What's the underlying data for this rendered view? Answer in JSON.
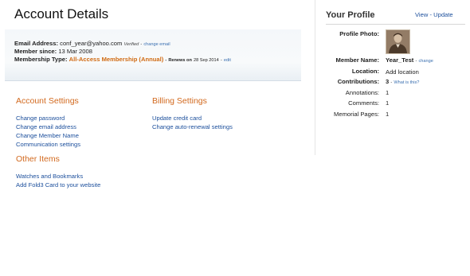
{
  "account": {
    "title": "Account Details",
    "email_label": "Email Address:",
    "email_value": "conf_year@yahoo.com",
    "verified_label": "Verified",
    "change_email_link": "change email",
    "member_since_label": "Member since:",
    "member_since_value": "13 Mar 2008",
    "membership_label": "Membership Type:",
    "membership_value": "All-Access Membership (Annual)",
    "renews_label": "Renews on",
    "renews_date": "28 Sep 2014",
    "edit_link": "edit"
  },
  "account_settings": {
    "title": "Account Settings",
    "links": [
      "Change password",
      "Change email address",
      "Change Member Name",
      "Communication settings"
    ]
  },
  "billing_settings": {
    "title": "Billing Settings",
    "links": [
      "Update credit card",
      "Change auto-renewal settings"
    ]
  },
  "other_items": {
    "title": "Other Items",
    "links": [
      "Watches and Bookmarks",
      "Add Fold3 Card to your website"
    ]
  },
  "profile": {
    "title": "Your Profile",
    "view_link": "View",
    "separator": "-",
    "update_link": "Update",
    "photo_label": "Profile Photo:",
    "member_name_label": "Member Name:",
    "member_name_value": "Year_Test",
    "change_link": "change",
    "location_label": "Location:",
    "add_location_link": "Add location",
    "contributions_label": "Contributions:",
    "contributions_value": "3",
    "what_is_this_link": "What is this?",
    "annotations_label": "Annotations:",
    "annotations_value": "1",
    "comments_label": "Comments:",
    "comments_value": "1",
    "memorial_pages_label": "Memorial Pages:",
    "memorial_pages_value": "1"
  },
  "colors": {
    "section_title": "#d2691e",
    "link": "#1c4f9c",
    "membership": "#d06a12"
  }
}
